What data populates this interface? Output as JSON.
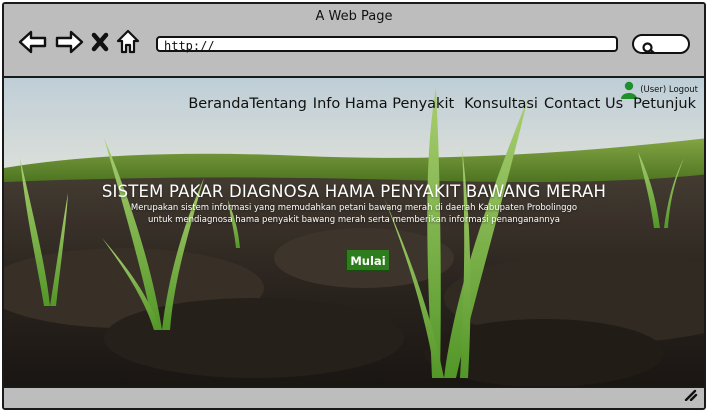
{
  "window": {
    "title": "A Web Page"
  },
  "browser": {
    "url": "http://"
  },
  "user": {
    "label": "(User) Logout"
  },
  "nav": {
    "items": [
      {
        "label": "Beranda"
      },
      {
        "label": "Tentang"
      },
      {
        "label": "Info Hama Penyakit"
      },
      {
        "label": "Konsultasi"
      },
      {
        "label": "Contact Us"
      },
      {
        "label": "Petunjuk"
      }
    ]
  },
  "hero": {
    "title": "SISTEM PAKAR DIAGNOSA HAMA PENYAKIT BAWANG MERAH",
    "subtitle_line1": "Merupakan sistem informasi yang memudahkan petani bawang merah di daerah Kabupaten Probolinggo",
    "subtitle_line2": "untuk mendiagnosa hama penyakit bawang merah serta memberikan informasi penanganannya",
    "button": "Mulai"
  },
  "icons": {
    "back": "arrow-left-icon",
    "forward": "arrow-right-icon",
    "stop": "close-icon",
    "home": "home-icon",
    "search": "search-icon",
    "user": "user-icon",
    "resize": "resize-grip-icon"
  },
  "colors": {
    "button": "#2e7d1c",
    "frame": "#bdbdbd"
  }
}
